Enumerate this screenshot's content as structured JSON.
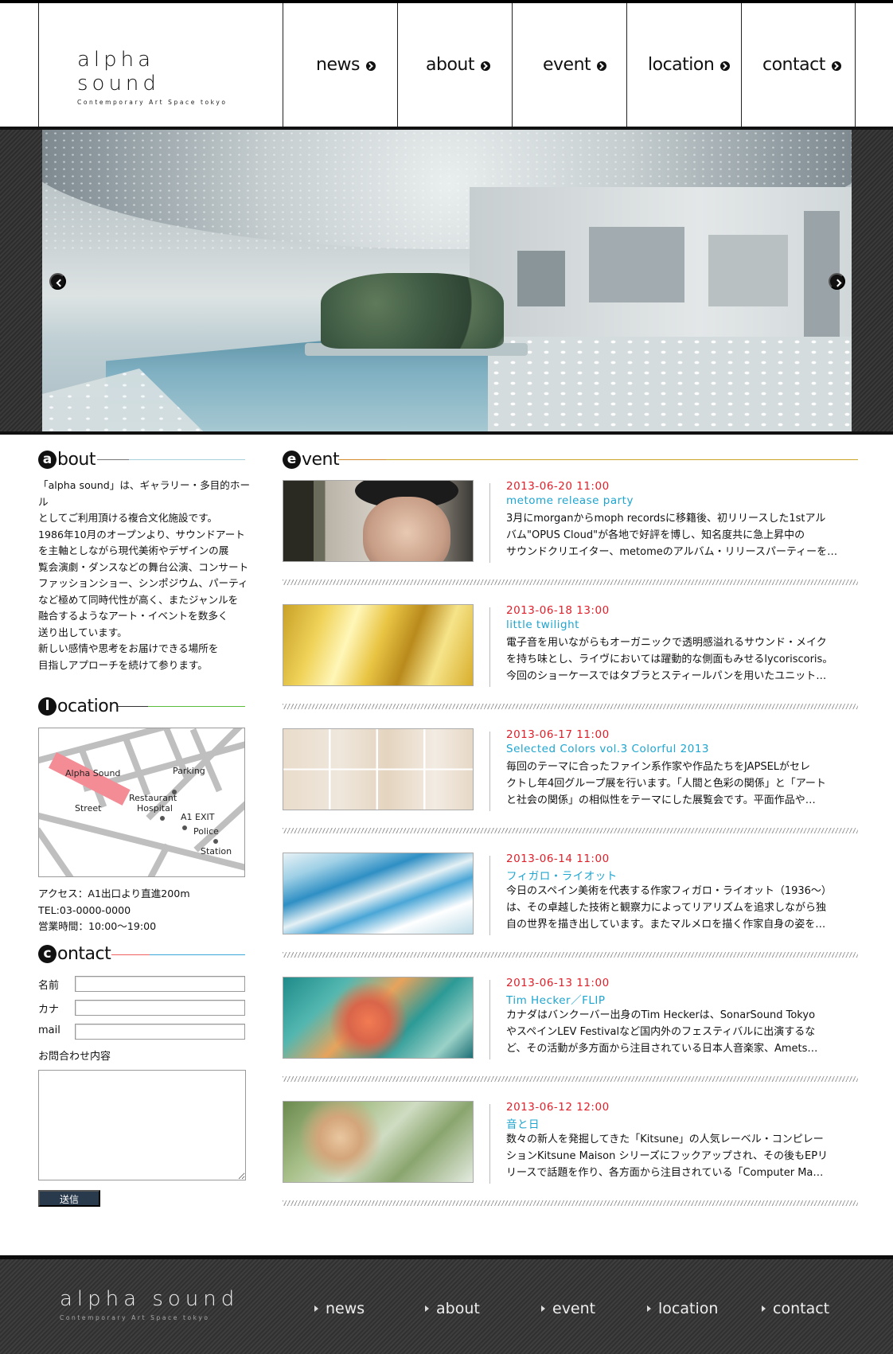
{
  "brand": {
    "name": "alpha sound",
    "tagline": "Contemporary Art Space tokyo"
  },
  "nav": [
    {
      "label": "news"
    },
    {
      "label": "about"
    },
    {
      "label": "event"
    },
    {
      "label": "location"
    },
    {
      "label": "contact"
    }
  ],
  "about": {
    "heading_letter": "a",
    "heading_rest": "bout",
    "text": "「alpha sound」は、ギャラリー・多目的ホール\nとしてご利用頂ける複合文化施設です。\n1986年10月のオープンより、サウンドアート\nを主軸としながら現代美術やデザインの展\n覧会演劇・ダンスなどの舞台公演、コンサート\nファッションショー、シンポジウム、パーティ\nなど極めて同時代性が高く、またジャンルを\n融合するようなアート・イベントを数多く\n送り出しています。\n新しい感情や思考をお届けできる場所を\n目指しアプローチを続けて参ります。"
  },
  "location": {
    "heading_letter": "l",
    "heading_rest": "ocation",
    "map_labels": {
      "alpha_sound": "Alpha Sound",
      "parking": "Parking",
      "restaurant": "Restaurant",
      "hospital": "Hospital",
      "street": "Street",
      "a1_exit": "A1 EXIT",
      "police": "Police",
      "station": "Station"
    },
    "access": "アクセス：A1出口より直進200m",
    "tel": "TEL:03-0000-0000",
    "hours": "営業時間：10:00〜19:00"
  },
  "contact": {
    "heading_letter": "c",
    "heading_rest": "ontact",
    "name_label": "名前",
    "kana_label": "カナ",
    "mail_label": "mail",
    "inquiry_label": "お問合わせ内容",
    "submit_label": "送信"
  },
  "event_section": {
    "heading_letter": "e",
    "heading_rest": "vent"
  },
  "events": [
    {
      "date": "2013-06-20 11:00",
      "title": "metome release party",
      "lines": [
        "3月にmorganからmoph recordsに移籍後、初リリースした1stアル",
        "バム\"OPUS Cloud\"が各地で好評を博し、知名度共に急上昇中の",
        "サウンドクリエイター、metomeのアルバム・リリースパーティーを…"
      ]
    },
    {
      "date": "2013-06-18 13:00",
      "title": "little twilight",
      "lines": [
        "電子音を用いながらもオーガニックで透明感溢れるサウンド・メイク",
        "を持ち味とし、ライヴにおいては躍動的な側面もみせるlycoriscoris。",
        "今回のショーケースではタブラとスティールパンを用いたユニット…"
      ]
    },
    {
      "date": "2013-06-17 11:00",
      "title": "Selected Colors vol.3 Colorful 2013",
      "lines": [
        "毎回のテーマに合ったファイン系作家や作品たちをJAPSELがセレ",
        "クトし年4回グループ展を行います。「人間と色彩の関係」と「アート",
        "と社会の関係」の相似性をテーマにした展覧会です。平面作品や…"
      ]
    },
    {
      "date": "2013-06-14 11:00",
      "title": "フィガロ・ライオット",
      "lines": [
        "今日のスペイン美術を代表する作家フィガロ・ライオット（1936〜）",
        "は、その卓越した技術と観察力によってリアリズムを追求しながら独",
        "自の世界を描き出しています。またマルメロを描く作家自身の姿を…"
      ]
    },
    {
      "date": "2013-06-13 11:00",
      "title": "Tim Hecker／FLIP",
      "lines": [
        "カナダはバンクーバー出身のTim Heckerは、SonarSound Tokyo",
        "やスペインLEV Festivalなど国内外のフェスティバルに出演するな",
        "ど、その活動が多方面から注目されている日本人音楽家、Amets…"
      ]
    },
    {
      "date": "2013-06-12 12:00",
      "title": "音と日",
      "lines": [
        "数々の新人を発掘してきた「Kitsune」の人気レーベル・コンピレー",
        "ションKitsune Maison シリーズにフックアップされ、その後もEPリ",
        "リースで話題を作り、各方面から注目されている「Computer Ma…"
      ]
    }
  ],
  "footer": {
    "name": "alpha sound",
    "tagline": "Contemporary Art Space tokyo",
    "nav": [
      {
        "label": "news"
      },
      {
        "label": "about"
      },
      {
        "label": "event"
      },
      {
        "label": "location"
      },
      {
        "label": "contact"
      }
    ]
  },
  "colors": {
    "date_red": "#e0202a",
    "title_cyan": "#1ea5cf",
    "submit_navy": "#2a3a4d"
  },
  "icons": {
    "carousel_prev": "chevron-left-icon",
    "carousel_next": "chevron-right-icon",
    "nav_arrow": "circle-arrow-icon",
    "footer_arrow": "triangle-right-icon"
  }
}
